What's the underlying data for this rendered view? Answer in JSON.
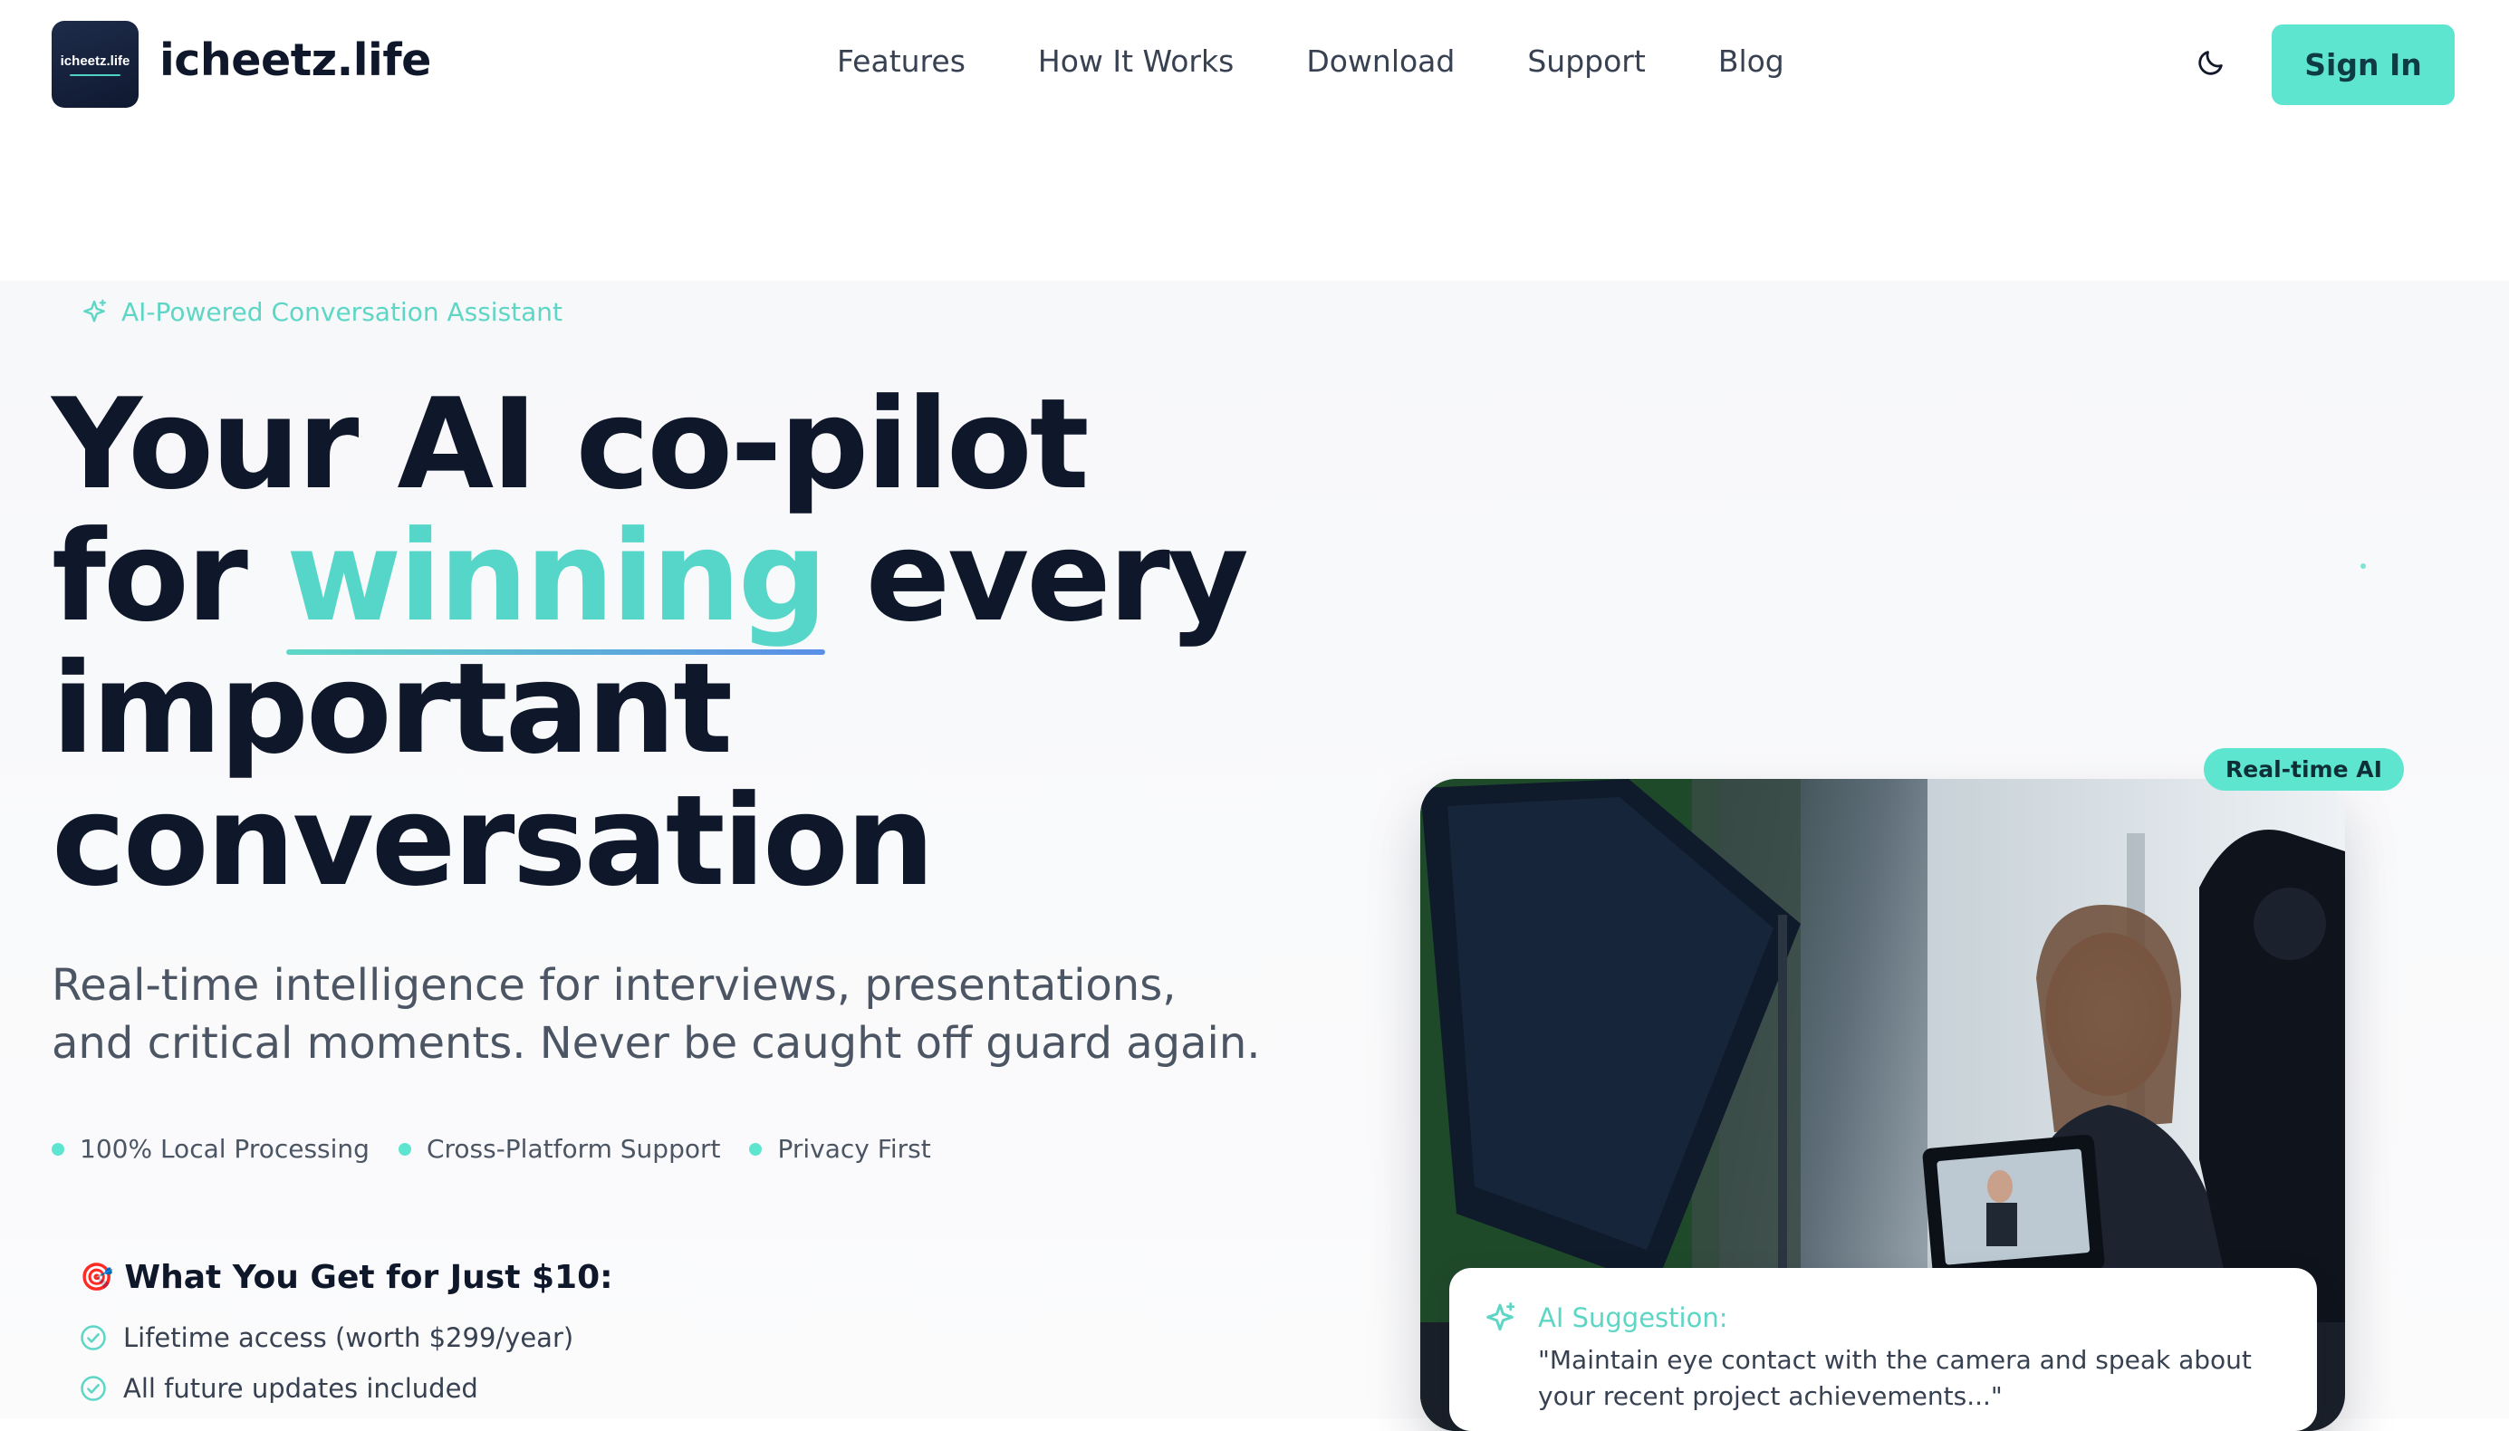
{
  "brand": {
    "logo_text": "icheetz.life",
    "name": "icheetz.life"
  },
  "nav": {
    "items": [
      "Features",
      "How It Works",
      "Download",
      "Support",
      "Blog"
    ],
    "signin_label": "Sign In"
  },
  "hero": {
    "badge": "AI-Powered Conversation Assistant",
    "headline": {
      "line1": "Your AI co-pilot",
      "line2_pre": "for ",
      "line2_accent": "winning",
      "line2_post": " every",
      "line3": "important",
      "line4": "conversation"
    },
    "subtitle": "Real-time intelligence for interviews, presentations, and critical moments. Never be caught off guard again.",
    "features": [
      "100% Local Processing",
      "Cross-Platform Support",
      "Privacy First"
    ],
    "offer": {
      "emoji": "🎯",
      "title": "What You Get for Just $10:",
      "items": [
        "Lifetime access (worth $299/year)",
        "All future updates included"
      ]
    }
  },
  "demo": {
    "badge": "Real-time AI",
    "suggestion_title": "AI Suggestion:",
    "suggestion_text": "\"Maintain eye contact with the camera and speak about your recent project achievements...\""
  },
  "colors": {
    "accent": "#5ee5cf",
    "accent_text": "#55d6c8",
    "heading": "#0f172a",
    "body": "#4b5563"
  }
}
